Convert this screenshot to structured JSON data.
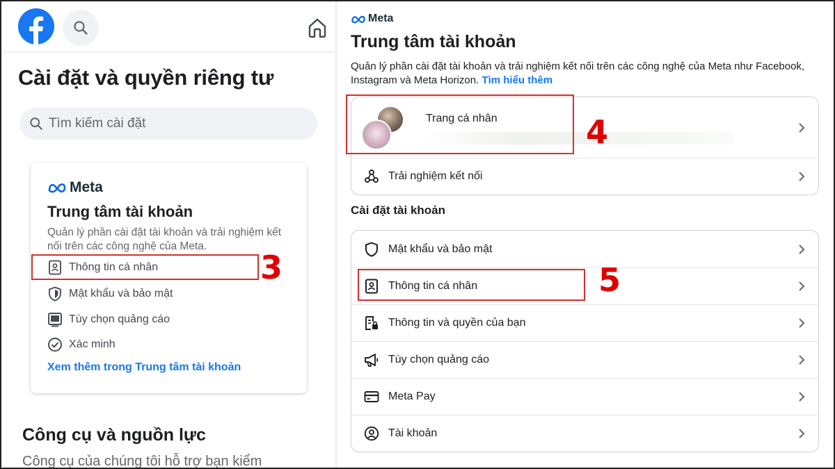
{
  "left": {
    "settings_title": "Cài đặt và quyền riêng tư",
    "search_placeholder": "Tìm kiếm cài đặt",
    "meta_card": {
      "brand": "Meta",
      "title": "Trung tâm tài khoản",
      "description": "Quản lý phần cài đặt tài khoản và trải nghiệm kết nối trên các công nghệ của Meta.",
      "items": [
        {
          "label": "Thông tin cá nhân",
          "icon": "id-card-icon"
        },
        {
          "label": "Mật khẩu và bảo mật",
          "icon": "shield-icon"
        },
        {
          "label": "Tùy chọn quảng cáo",
          "icon": "monitor-icon"
        },
        {
          "label": "Xác minh",
          "icon": "check-circle-icon"
        }
      ],
      "link": "Xem thêm trong Trung tâm tài khoản"
    },
    "tools_title": "Công cụ và nguồn lực",
    "tools_desc": "Công cụ của chúng tôi hỗ trợ bạn kiểm"
  },
  "right": {
    "brand": "Meta",
    "title": "Trung tâm tài khoản",
    "description": "Quản lý phần cài đặt tài khoản và trải nghiệm kết nối trên các công nghệ của Meta như Facebook, Instagram và Meta Horizon.",
    "learn_more": "Tìm hiểu thêm",
    "profile_label": "Trang cá nhân",
    "connected_label": "Trải nghiệm kết nối",
    "account_settings_title": "Cài đặt tài khoản",
    "settings": [
      {
        "label": "Mật khẩu và bảo mật",
        "icon": "shield-icon"
      },
      {
        "label": "Thông tin cá nhân",
        "icon": "id-card-icon"
      },
      {
        "label": "Thông tin và quyền của bạn",
        "icon": "info-lock-icon"
      },
      {
        "label": "Tùy chọn quảng cáo",
        "icon": "megaphone-icon"
      },
      {
        "label": "Meta Pay",
        "icon": "credit-card-icon"
      },
      {
        "label": "Tài khoản",
        "icon": "user-circle-icon"
      }
    ]
  },
  "annotations": [
    "3",
    "4",
    "5"
  ],
  "colors": {
    "facebook_blue": "#1877f2",
    "annotation_red": "#e00000",
    "text_primary": "#1c1e21",
    "text_secondary": "#65676b"
  }
}
